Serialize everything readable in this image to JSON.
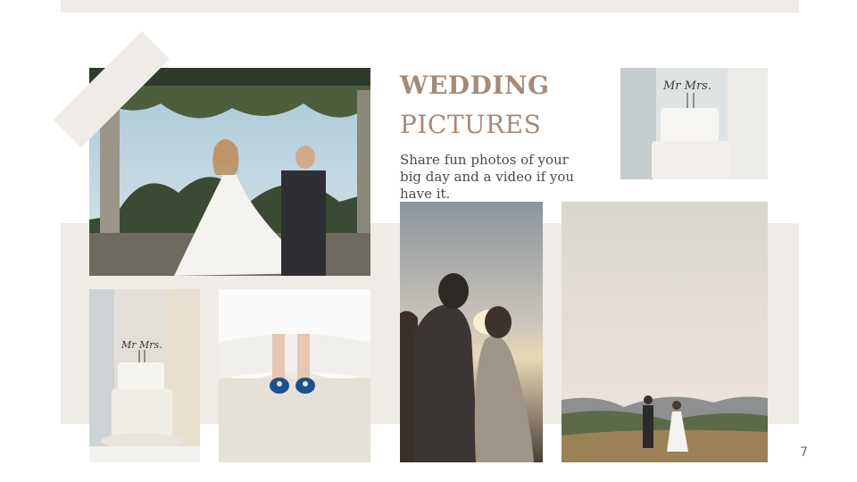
{
  "slide": {
    "title_line1": "WEDDING",
    "title_line2": "PICTURES",
    "description": "Share fun photos of your big day and a video if you have it.",
    "page_number": "7"
  },
  "cake_topper": "Mr Mrs.",
  "colors": {
    "accent": "#a58b78",
    "band": "#efebe7",
    "text": "#4a4a4a"
  }
}
